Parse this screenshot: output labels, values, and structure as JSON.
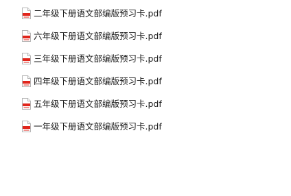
{
  "files": [
    {
      "name": "二年级下册语文部编版预习卡.pdf",
      "icon": "pdf-file-icon",
      "accent": "#e1251b"
    },
    {
      "name": "六年级下册语文部编版预习卡.pdf",
      "icon": "pdf-file-icon",
      "accent": "#e1251b"
    },
    {
      "name": "三年级下册语文部编版预习卡.pdf",
      "icon": "pdf-file-icon",
      "accent": "#e1251b"
    },
    {
      "name": "四年级下册语文部编版预习卡.pdf",
      "icon": "pdf-file-icon",
      "accent": "#e1251b"
    },
    {
      "name": "五年级下册语文部编版预习卡.pdf",
      "icon": "pdf-file-icon",
      "accent": "#e1251b"
    },
    {
      "name": "一年级下册语文部编版预习卡.pdf",
      "icon": "pdf-file-icon",
      "accent": "#e1251b"
    }
  ]
}
